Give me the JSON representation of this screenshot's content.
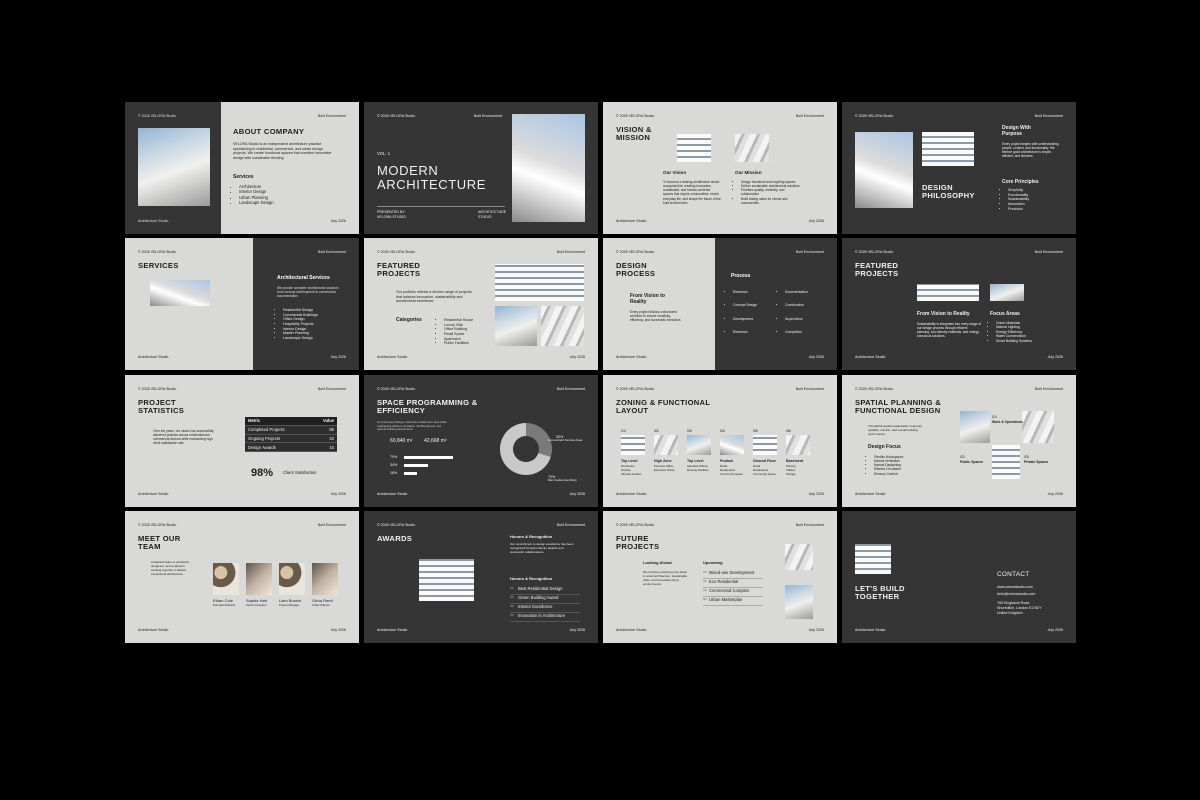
{
  "common": {
    "copyright": "© 2026 VELORA Studio",
    "built": "Built Environment",
    "studio": "Architecture Studio",
    "date": "July 2026"
  },
  "s1": {
    "title": "ABOUT COMPANY",
    "para": "VELORA Studio is an independent architecture practice specializing in residential, commercial, and urban design projects. We create functional spaces that combine innovative design with sustainable thinking.",
    "services_label": "Services",
    "services": [
      "Architecture",
      "Interior Design",
      "Urban Planning",
      "Landscape Design"
    ]
  },
  "s2": {
    "vol": "VOL. 1",
    "title1": "MODERN",
    "title2": "ARCHITECTURE",
    "presented": "PRESENTED BY",
    "presented_by": "VELORA STUDIO",
    "arch": "ARCHITECTURE",
    "arch2": "STUDIO"
  },
  "s3": {
    "title1": "VISION &",
    "title2": "MISSION",
    "vision_label": "Our Vision",
    "vision": "To become a leading architecture studio recognized for creating innovative, sustainable, and human-centered spaces that inspire communities, enrich everyday life, and shape the future of the built environment.",
    "mission_label": "Our Mission",
    "mission": [
      "Design functional and inspiring spaces",
      "Deliver sustainable architectural solutions",
      "Prioritize quality, creativity, and collaboration",
      "Build lasting value for clients and communities"
    ]
  },
  "s4": {
    "title": "DESIGN WITH PURPOSE",
    "title1": "Design With",
    "title2": "Purpose",
    "para": "Every project begins with understanding people, context, and functionality. We believe good architecture is simple, efficient, and timeless.",
    "p1": "DESIGN",
    "p2": "PHILOSOPHY",
    "principles_label": "Core Principles",
    "principles": [
      "Simplicity",
      "Functionality",
      "Sustainability",
      "Innovation",
      "Precision"
    ]
  },
  "s5": {
    "title": "SERVICES",
    "arch_label": "Architectural Services",
    "para": "We provide complete architectural solutions from concept development to construction documentation.",
    "items": [
      "Residential Design",
      "Commercial Buildings",
      "Office Design",
      "Hospitality Projects",
      "Interior Design",
      "Master Planning",
      "Landscape Design"
    ]
  },
  "s6": {
    "title1": "FEATURED",
    "title2": "PROJECTS",
    "para": "Our portfolio reflects a diverse range of projects that balance innovation, sustainability and architectural excellence.",
    "cat_label": "Categories",
    "cats": [
      "Residential House",
      "Luxury Villa",
      "Office Building",
      "Retail Space",
      "Apartment",
      "Public Facilities"
    ]
  },
  "s7": {
    "title1": "DESIGN",
    "title2": "PROCESS",
    "sub1": "From Vision to",
    "sub2": "Reality",
    "para": "Every project follows a structured workflow to ensure creativity, efficiency, and successful execution.",
    "process_label": "Process",
    "col1": [
      "Research",
      "Concept Design",
      "Development",
      "Research"
    ],
    "col2": [
      "Documentation",
      "Construction",
      "Supervision",
      "Completion"
    ]
  },
  "s8": {
    "title1": "FEATURED",
    "title2": "PROJECTS",
    "sub": "From Vision to Reality",
    "focus_label": "Focus Areas",
    "para": "Sustainability is integrated into every stage of our design process through efficient planning, eco-friendly materials, and energy-conscious solutions.",
    "focus": [
      "Green Materials",
      "Natural Lighting",
      "Energy Efficiency",
      "Water Conservation",
      "Smart Building Systems"
    ]
  },
  "s9": {
    "title1": "PROJECT",
    "title2": "STATISTICS",
    "para": "Over the years, our studio has successfully delivered projects across residential and commercial sectors while maintaining high client satisfaction rate.",
    "table": {
      "h1": "Metric",
      "h2": "Value",
      "rows": [
        [
          "Completed Projects",
          "85"
        ],
        [
          "Ongoing Projects",
          "22"
        ],
        [
          "Design Awards",
          "15"
        ]
      ]
    },
    "pct": "98%",
    "pct_label": "Client Satisfaction"
  },
  "s10": {
    "title1": "SPACE PROGRAMMING &",
    "title2": "EFFICIENCY",
    "para": "Our planning strategy maximizes usable floor area while maintaining efficient circulation, flexible layouts, and optimal building performance.",
    "m1": "60,840 m²",
    "m2": "42,668 m²",
    "bars": [
      {
        "label": "70%",
        "v": 0.7
      },
      {
        "label": "34%",
        "v": 0.34
      },
      {
        "label": "18%",
        "v": 0.18
      }
    ],
    "d1": "30%",
    "d1b": "Commercial & Services Areas",
    "d2": "70%",
    "d2b": "Main Usable Area (Flats)"
  },
  "s11": {
    "title1": "ZONING & FUNCTIONAL",
    "title2": "LAYOUT",
    "cols": [
      {
        "n": "01/",
        "t": "Top Level",
        "i": [
          "Penthouse",
          "Rooftop",
          "Skyview Garden"
        ]
      },
      {
        "n": "02/",
        "t": "High Zone",
        "i": [
          "Premium Office",
          "Executive Suites"
        ]
      },
      {
        "n": "03/",
        "t": "Top Level",
        "i": [
          "Standard Offices",
          "Meeting Facilities"
        ]
      },
      {
        "n": "04/",
        "t": "Podium",
        "i": [
          "Retail",
          "Restaurants",
          "Community Space"
        ]
      },
      {
        "n": "05/",
        "t": "Ground Floor",
        "i": [
          "Retail",
          "Restaurants",
          "Community Space"
        ]
      },
      {
        "n": "06/",
        "t": "Basement",
        "i": [
          "Parking",
          "Utilities",
          "Storage"
        ]
      }
    ]
  },
  "s12": {
    "title1": "SPATIAL PLANNING &",
    "title2": "FUNCTIONAL DESIGN",
    "para": "Thoughtful spatial organization improves usability, comfort, and overall building performance.",
    "focus_label": "Design Focus",
    "focus": [
      "Flexible Workspaces",
      "Natural Ventilation",
      "Natural Daylighting",
      "Efficient Circulation",
      "Sensory Comfort"
    ],
    "w1": "01/",
    "w1t": "Work & Operations",
    "w2": "02/",
    "w2t": "Public Spaces",
    "w3": "03/",
    "w3t": "Private Spaces"
  },
  "s13": {
    "title1": "MEET OUR",
    "title2": "TEAM",
    "para": "A talented team of architects, designers, and engineers working together to deliver exceptional architecture.",
    "members": [
      {
        "name": "Ethan Cole",
        "role": "Principal Architect"
      },
      {
        "name": "Sophia Hart",
        "role": "Interior Designer"
      },
      {
        "name": "Liam Brooks",
        "role": "Project Manager"
      },
      {
        "name": "Olivia Reed",
        "role": "Urban Planner"
      }
    ]
  },
  "s14": {
    "title": "AWARDS",
    "h1": "Honors & Recognition",
    "para": "Our commitment to design excellence has been recognized through industry awards and successful collaborations.",
    "h2": "Honors & Recognition",
    "awards": [
      {
        "n": "01/",
        "t": "Best Residential Design"
      },
      {
        "n": "02/",
        "t": "Green Building Award"
      },
      {
        "n": "03/",
        "t": "Interior Excellence"
      },
      {
        "n": "04/",
        "t": "Innovation in Architecture"
      }
    ]
  },
  "s15": {
    "title1": "FUTURE",
    "title2": "PROJECTS",
    "ahead": "Looking Ahead",
    "para": "We continue exploring new ideas in smart architecture, sustainable cities, and innovative living environments.",
    "upcoming": "Upcoming",
    "items": [
      {
        "n": "01/",
        "t": "Mixed-use Development"
      },
      {
        "n": "02/",
        "t": "Eco Residential"
      },
      {
        "n": "03/",
        "t": "Commercial Complex"
      },
      {
        "n": "04/",
        "t": "Urban Masterplan"
      }
    ]
  },
  "s16": {
    "title1": "LET'S BUILD",
    "title2": "TOGETHER",
    "contact": "CONTACT",
    "web": "www.velorastudio.com",
    "mail": "hello@velorastudio.com",
    "addr1": "765 Kingsland Road",
    "addr2": "Shoreditch, London E2 8DY",
    "addr3": "United Kingdom"
  }
}
